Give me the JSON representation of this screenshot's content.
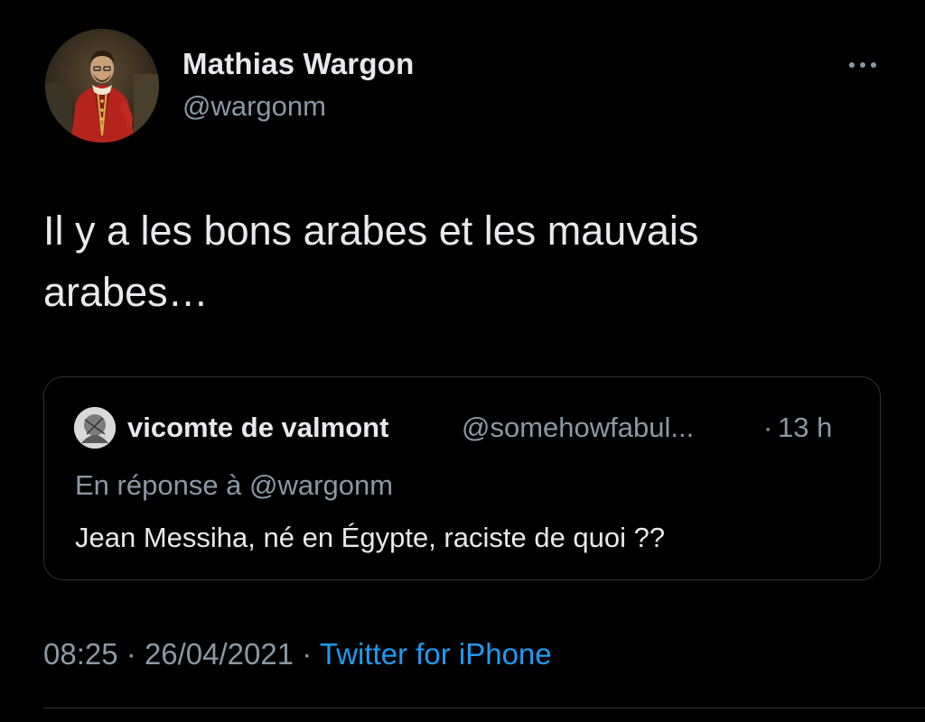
{
  "author": {
    "display_name": "Mathias Wargon",
    "handle": "@wargonm",
    "avatar": "portrait-in-red-uniform"
  },
  "more_icon": "more-horizontal-icon",
  "tweet": {
    "text": "Il y a les bons arabes et les mauvais arabes…"
  },
  "quote": {
    "display_name": "vicomte de valmont",
    "handle": "@somehowfabul...",
    "separator": "·",
    "time": "13 h",
    "reply_prefix": "En réponse à",
    "reply_to": "@wargonm",
    "text": "Jean Messiha, né en Égypte, raciste de quoi ??"
  },
  "meta": {
    "time": "08:25",
    "dot1": "·",
    "date": "26/04/2021",
    "dot2": "·",
    "source": "Twitter for iPhone"
  },
  "colors": {
    "background": "#000000",
    "primary_text": "#e7e9ea",
    "secondary_text": "#8b98a5",
    "link": "#1d9bf0",
    "border": "#2f3336"
  }
}
